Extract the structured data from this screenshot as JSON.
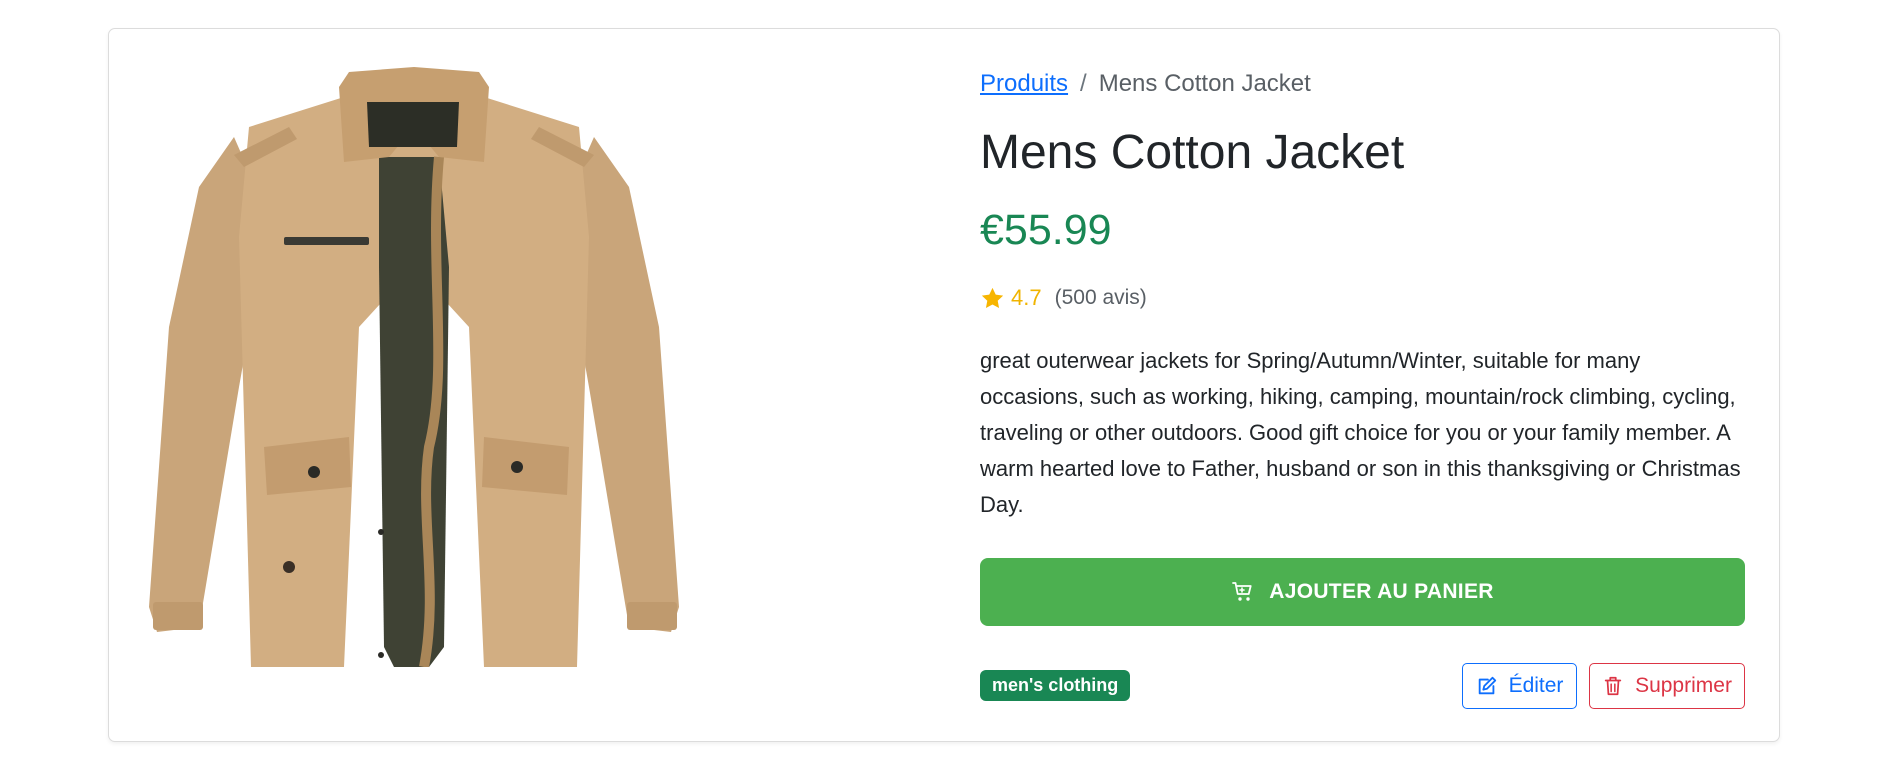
{
  "breadcrumb": {
    "parent_label": "Produits",
    "separator": "/",
    "current_label": "Mens Cotton Jacket"
  },
  "product": {
    "title": "Mens Cotton Jacket",
    "price": "€55.99",
    "rating": {
      "score": "4.7",
      "reviews": "(500 avis)",
      "icon": "star-icon"
    },
    "description": "great outerwear jackets for Spring/Autumn/Winter, suitable for many occasions, such as working, hiking, camping, mountain/rock climbing, cycling, traveling or other outdoors. Good gift choice for you or your family member. A warm hearted love to Father, husband or son in this thanksgiving or Christmas Day.",
    "category": "men's clothing",
    "image_icon": "jacket-image"
  },
  "actions": {
    "add_to_cart_label": "AJOUTER AU PANIER",
    "add_to_cart_icon": "cart-icon",
    "edit_label": "Éditer",
    "edit_icon": "edit-icon",
    "delete_label": "Supprimer",
    "delete_icon": "trash-icon"
  },
  "colors": {
    "link": "#0d6efd",
    "price": "#198754",
    "star": "#f0b400",
    "cart_button": "#4cb050",
    "badge": "#198754",
    "edit": "#0d6efd",
    "delete": "#dc3545"
  }
}
